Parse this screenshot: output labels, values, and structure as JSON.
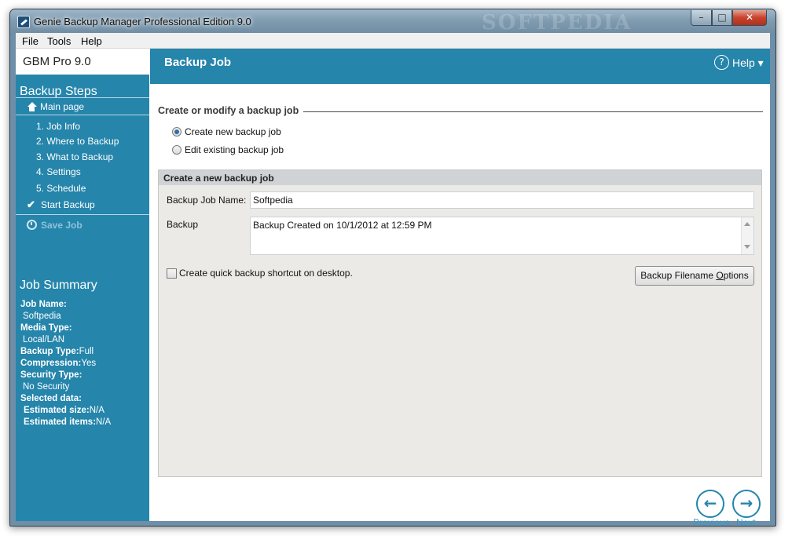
{
  "window": {
    "title": "Genie Backup Manager Professional Edition 9.0",
    "watermark": "SOFTPEDIA",
    "controls": {
      "minimize": "–",
      "maximize": "□",
      "close": "✕"
    }
  },
  "menu": [
    "File",
    "Tools",
    "Help"
  ],
  "sidebar": {
    "brand": "GBM Pro 9.0",
    "steps_title": "Backup Steps",
    "main_page": "Main page",
    "steps": [
      "1. Job Info",
      "2. Where to Backup",
      "3. What to Backup",
      "4. Settings",
      "5. Schedule"
    ],
    "start_backup": "Start Backup",
    "save_job": "Save Job",
    "summary_title": "Job Summary",
    "summary": {
      "job_name_label": "Job Name:",
      "job_name": "Softpedia",
      "media_type_label": "Media Type:",
      "media_type": "Local/LAN",
      "backup_type_label": "Backup Type:",
      "backup_type": "Full",
      "compression_label": "Compression:",
      "compression": "Yes",
      "security_type_label": "Security Type:",
      "security_type": "No Security",
      "selected_data_label": "Selected data:",
      "estimated_size_label": "Estimated size:",
      "estimated_size": "N/A",
      "estimated_items_label": "Estimated items:",
      "estimated_items": "N/A"
    }
  },
  "main": {
    "title": "Backup Job",
    "help_label": "Help ▾",
    "help_icon": "?",
    "section_title": "Create or modify a backup job",
    "radio_new": "Create new backup job",
    "radio_edit": "Edit existing backup job",
    "group_title": "Create a new backup job",
    "name_label": "Backup Job Name:",
    "name_value": "Softpedia",
    "backup_label": "Backup",
    "backup_value": "Backup Created on 10/1/2012 at 12:59 PM",
    "shortcut_label": "Create quick backup shortcut on desktop.",
    "options_button_pre": "Backup Filename ",
    "options_button_key": "O",
    "options_button_post": "ptions",
    "previous": "Previous",
    "next": "Next",
    "previous_arrow": "←",
    "next_arrow": "→"
  },
  "colors": {
    "accent": "#2585ab",
    "group_bg": "#eceae6",
    "group_head": "#d0d3d6"
  }
}
